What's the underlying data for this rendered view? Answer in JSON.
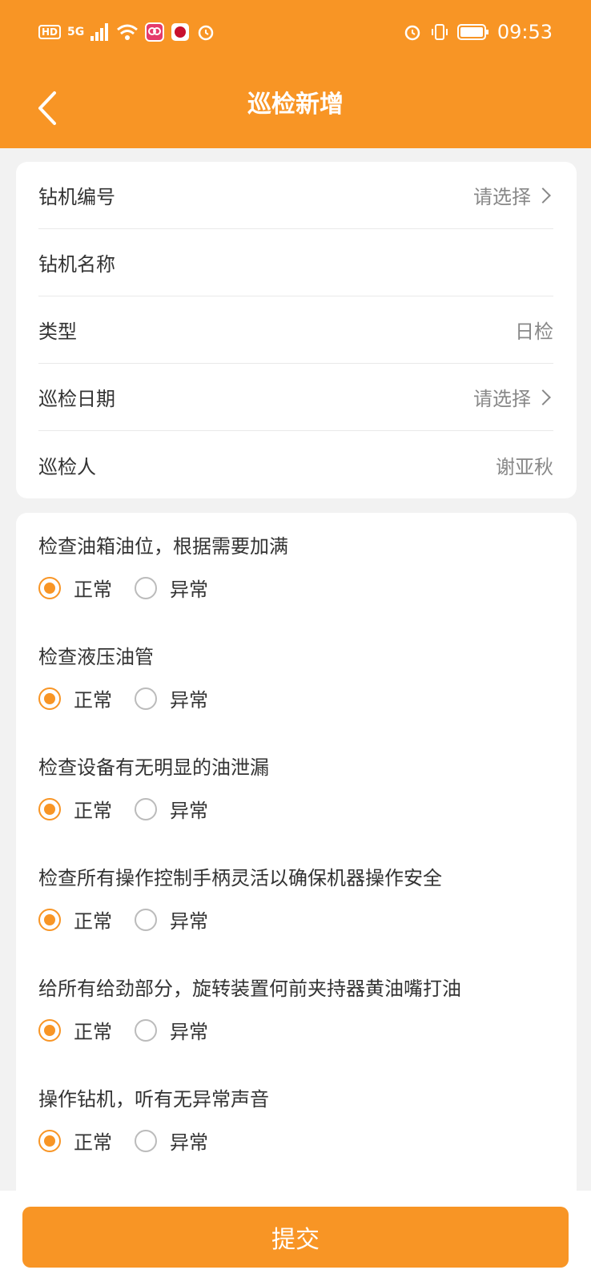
{
  "status_bar": {
    "left_badges": [
      "HD",
      "5G"
    ],
    "time": "09:53"
  },
  "header": {
    "title": "巡检新增"
  },
  "form": {
    "rows": [
      {
        "label": "钻机编号",
        "value": "请选择",
        "has_chevron": true
      },
      {
        "label": "钻机名称",
        "value": "",
        "has_chevron": false
      },
      {
        "label": "类型",
        "value": "日检",
        "has_chevron": false
      },
      {
        "label": "巡检日期",
        "value": "请选择",
        "has_chevron": true
      },
      {
        "label": "巡检人",
        "value": "谢亚秋",
        "has_chevron": false
      }
    ]
  },
  "checklist": {
    "items": [
      {
        "question": "检查油箱油位，根据需要加满",
        "normal": "正常",
        "abnormal": "异常",
        "selected": "正常"
      },
      {
        "question": "检查液压油管",
        "normal": "正常",
        "abnormal": "异常",
        "selected": "正常"
      },
      {
        "question": "检查设备有无明显的油泄漏",
        "normal": "正常",
        "abnormal": "异常",
        "selected": "正常"
      },
      {
        "question": "检查所有操作控制手柄灵活以确保机器操作安全",
        "normal": "正常",
        "abnormal": "异常",
        "selected": "正常"
      },
      {
        "question": "给所有给劲部分，旋转装置何前夹持器黄油嘴打油",
        "normal": "正常",
        "abnormal": "异常",
        "selected": "正常"
      },
      {
        "question": "操作钻机，听有无异常声音",
        "normal": "正常",
        "abnormal": "异常",
        "selected": "正常"
      }
    ]
  },
  "footer": {
    "submit_label": "提交"
  },
  "colors": {
    "accent": "#f89525",
    "background": "#f2f2f2"
  }
}
